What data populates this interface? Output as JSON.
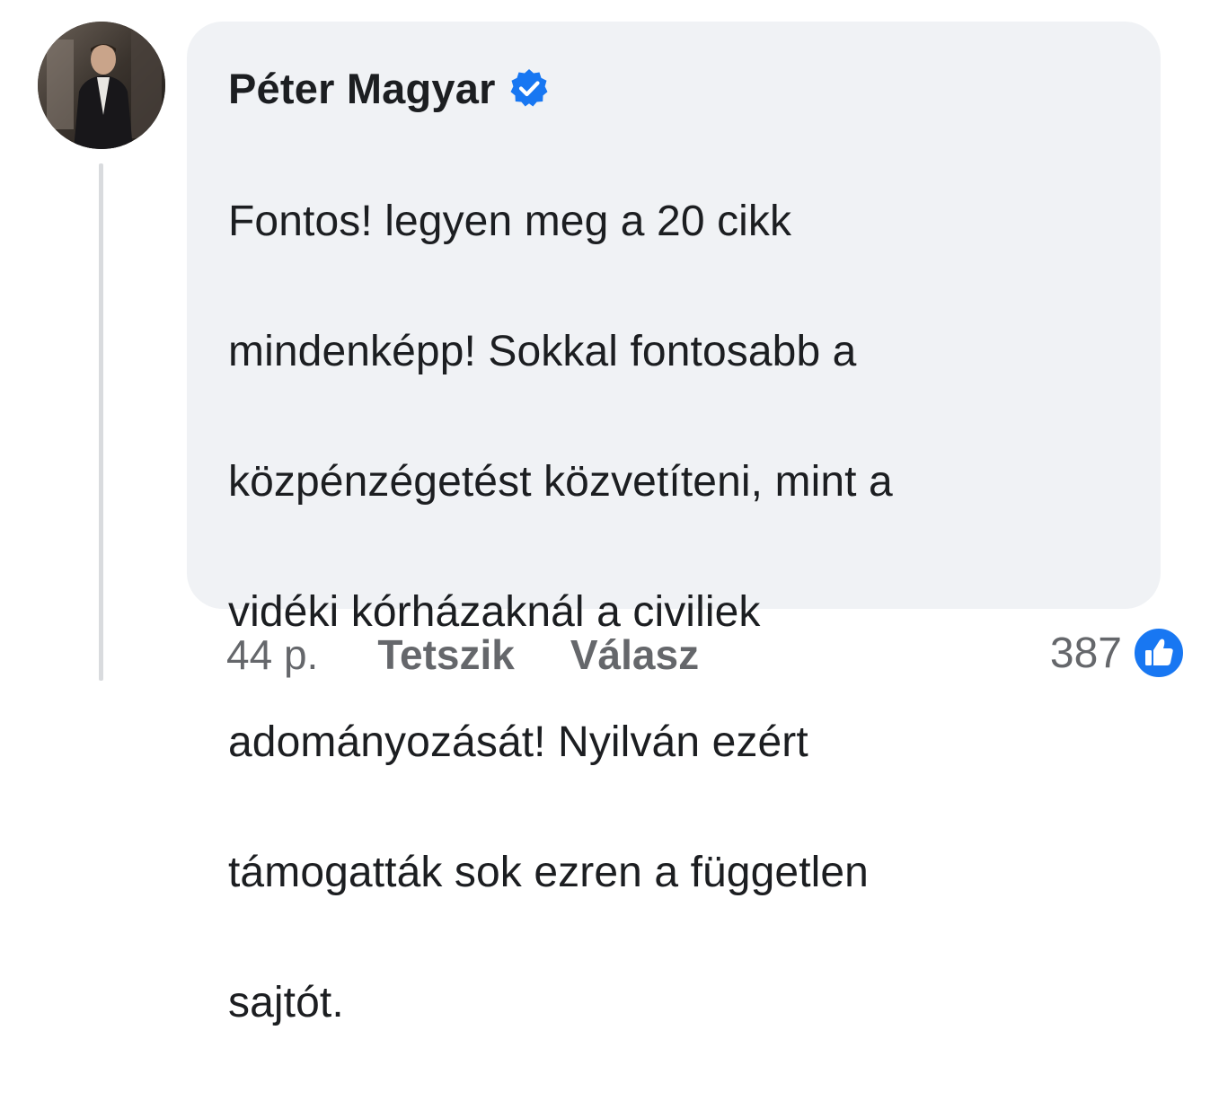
{
  "comment": {
    "author": "Péter Magyar",
    "verified": true,
    "text_lines": [
      "Fontos! legyen meg a 20 cikk",
      "mindenképp! Sokkal fontosabb a",
      "közpénzégetést közvetíteni, mint a",
      "vidéki kórházaknál a civiliek",
      "adományozását! Nyilván ezért",
      "támogatták sok ezren a független",
      "sajtót."
    ],
    "time": "44 p.",
    "like_label": "Tetszik",
    "reply_label": "Válasz",
    "reaction_count": "387",
    "reaction_icon": "like-icon"
  },
  "colors": {
    "bubble": "#f0f2f5",
    "text": "#1c1e21",
    "secondary": "#65676b",
    "accent": "#1877f2"
  }
}
